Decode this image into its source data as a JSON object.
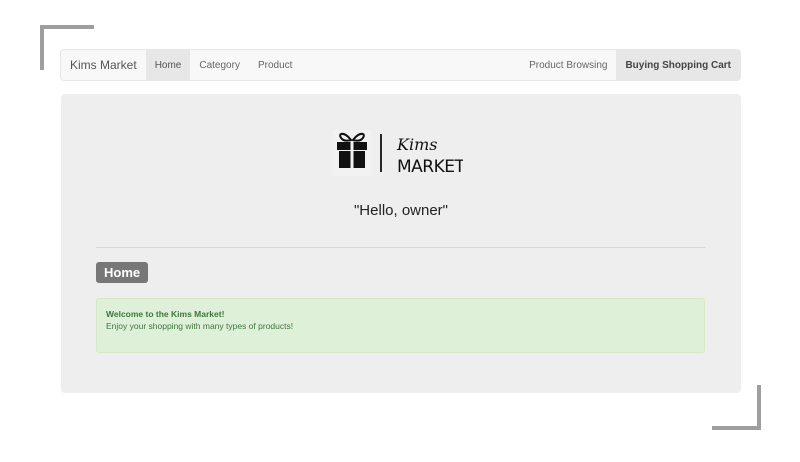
{
  "navbar": {
    "brand": "Kims Market",
    "items": [
      {
        "label": "Home"
      },
      {
        "label": "Category"
      },
      {
        "label": "Product"
      }
    ],
    "right_items": [
      {
        "label": "Product Browsing"
      },
      {
        "label": "Buying Shopping Cart"
      }
    ]
  },
  "logo": {
    "script_text": "Kims",
    "text": "MARKET",
    "icon": "gift-icon"
  },
  "greeting": "\"Hello, owner\"",
  "section_label": "Home",
  "alert": {
    "title": "Welcome to the Kims Market!",
    "message": "Enjoy your shopping with many types of products!"
  },
  "colors": {
    "label_bg": "#777777",
    "alert_bg": "#dff0d8",
    "alert_text": "#3c763d",
    "jumbotron_bg": "#eeeeee"
  }
}
